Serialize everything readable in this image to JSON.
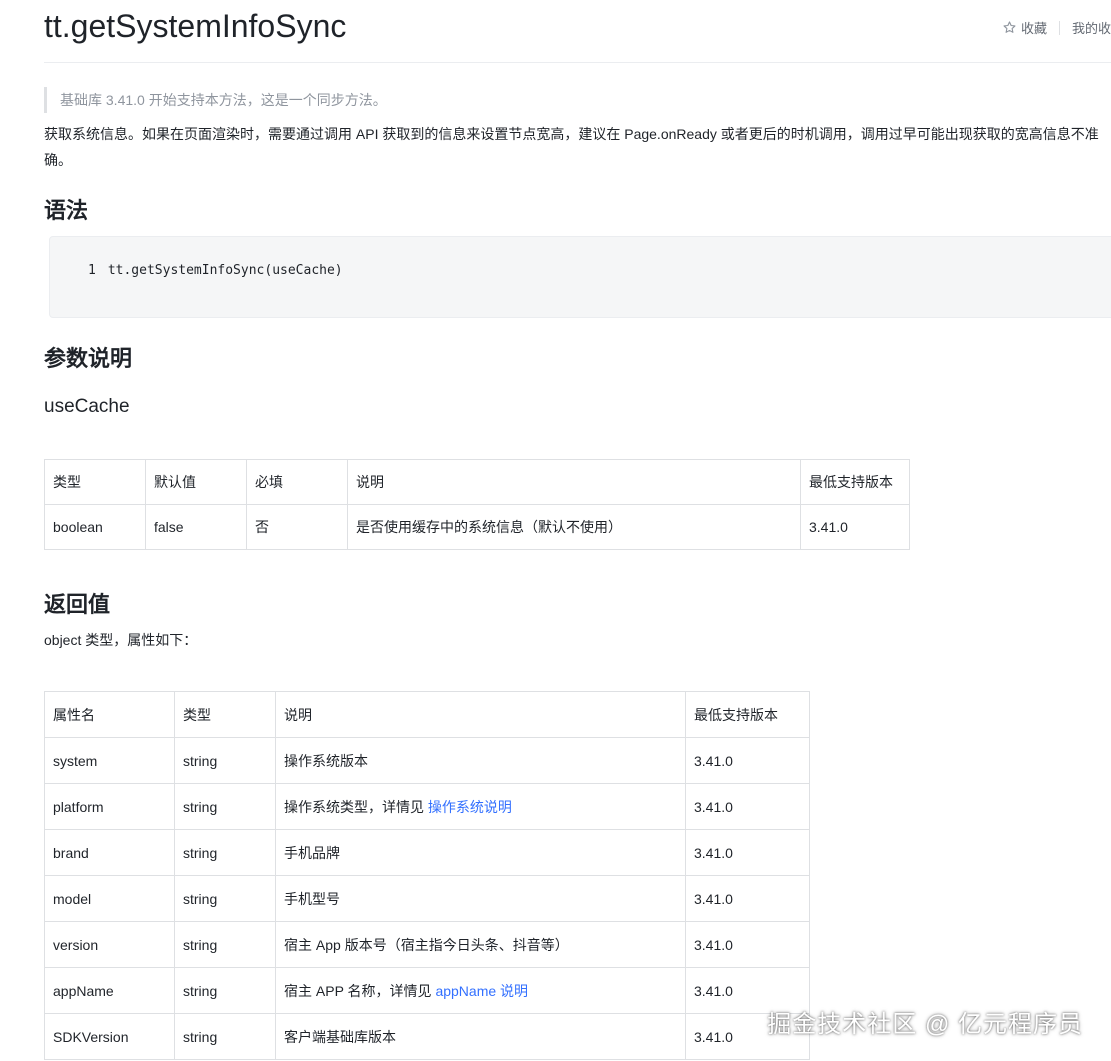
{
  "header": {
    "title": "tt.getSystemInfoSync",
    "favorite_label": "收藏",
    "my_favorites_label": "我的收"
  },
  "note": "基础库 3.41.0 开始支持本方法，这是一个同步方法。",
  "description": "获取系统信息。如果在页面渲染时，需要通过调用 API 获取到的信息来设置节点宽高，建议在 Page.onReady 或者更后的时机调用，调用过早可能出现获取的宽高信息不准确。",
  "syntax": {
    "heading": "语法",
    "line_number": "1",
    "code": "tt.getSystemInfoSync(useCache)"
  },
  "params": {
    "heading": "参数说明",
    "param_name": "useCache",
    "columns": [
      "类型",
      "默认值",
      "必填",
      "说明",
      "最低支持版本"
    ],
    "rows": [
      [
        "boolean",
        "false",
        "否",
        "是否使用缓存中的系统信息（默认不使用）",
        "3.41.0"
      ]
    ]
  },
  "returns": {
    "heading": "返回值",
    "intro": "object 类型，属性如下：",
    "columns": [
      "属性名",
      "类型",
      "说明",
      "最低支持版本"
    ],
    "rows": [
      {
        "name": "system",
        "type": "string",
        "desc": "操作系统版本",
        "link": "",
        "version": "3.41.0"
      },
      {
        "name": "platform",
        "type": "string",
        "desc": "操作系统类型，详情见 ",
        "link": "操作系统说明",
        "version": "3.41.0"
      },
      {
        "name": "brand",
        "type": "string",
        "desc": "手机品牌",
        "link": "",
        "version": "3.41.0"
      },
      {
        "name": "model",
        "type": "string",
        "desc": "手机型号",
        "link": "",
        "version": "3.41.0"
      },
      {
        "name": "version",
        "type": "string",
        "desc": "宿主 App 版本号（宿主指今日头条、抖音等）",
        "link": "",
        "version": "3.41.0"
      },
      {
        "name": "appName",
        "type": "string",
        "desc": "宿主 APP 名称，详情见 ",
        "link": "appName 说明",
        "version": "3.41.0"
      },
      {
        "name": "SDKVersion",
        "type": "string",
        "desc": "客户端基础库版本",
        "link": "",
        "version": "3.41.0"
      }
    ]
  },
  "watermark": "掘金技术社区 @ 亿元程序员",
  "colors": {
    "link": "#3370ff",
    "text": "#1f2329",
    "muted": "#8f959e",
    "border": "#dee0e3",
    "code_bg": "#f5f6f7"
  },
  "icons": {
    "favorite": "star-outline-icon"
  }
}
